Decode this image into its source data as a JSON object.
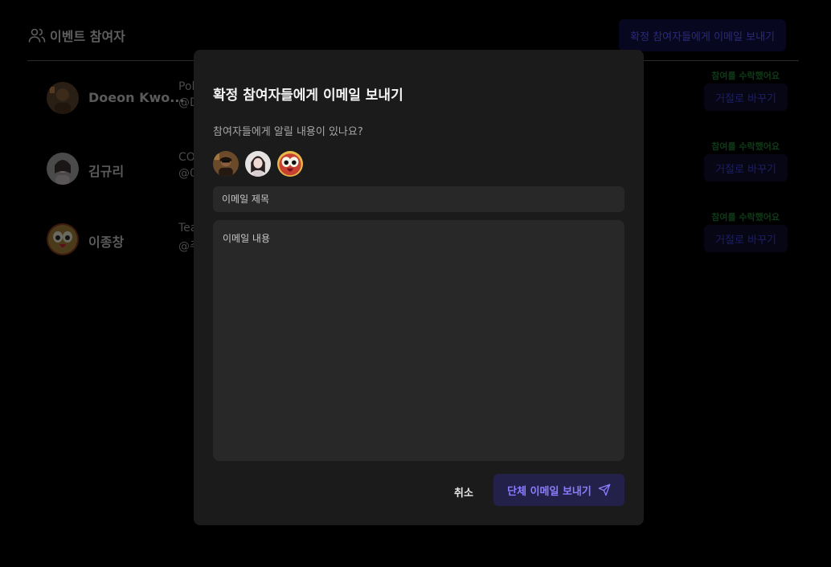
{
  "page": {
    "title": "이벤트 참여자",
    "bulk_email_label": "확정 참여자들에게 이메일 보내기"
  },
  "attendees": [
    {
      "name": "Doeon Kwo...",
      "role": "Pol",
      "handle": "@D",
      "status": "참여를 수락했어요",
      "reject_label": "거절로 바꾸기"
    },
    {
      "name": "김규리",
      "role": "CO",
      "handle": "@0",
      "status": "참여를 수락했어요",
      "reject_label": "거절로 바꾸기"
    },
    {
      "name": "이종창",
      "role": "Tea",
      "handle": "@주",
      "status": "참여를 수락했어요",
      "reject_label": "거절로 바꾸기"
    }
  ],
  "modal": {
    "title": "확정 참여자들에게 이메일 보내기",
    "subtitle": "참여자들에게 알릴 내용이 있나요?",
    "subject_placeholder": "이메일 제목",
    "body_placeholder": "이메일 내용",
    "cancel_label": "취소",
    "send_label": "단체 이메일 보내기"
  },
  "colors": {
    "accent": "#8a7dff",
    "send_bg": "#23204a",
    "modal_bg": "#1b1b1b",
    "status_green": "#0e3b16"
  },
  "icons": {
    "header": "users-icon",
    "send": "send-icon"
  }
}
